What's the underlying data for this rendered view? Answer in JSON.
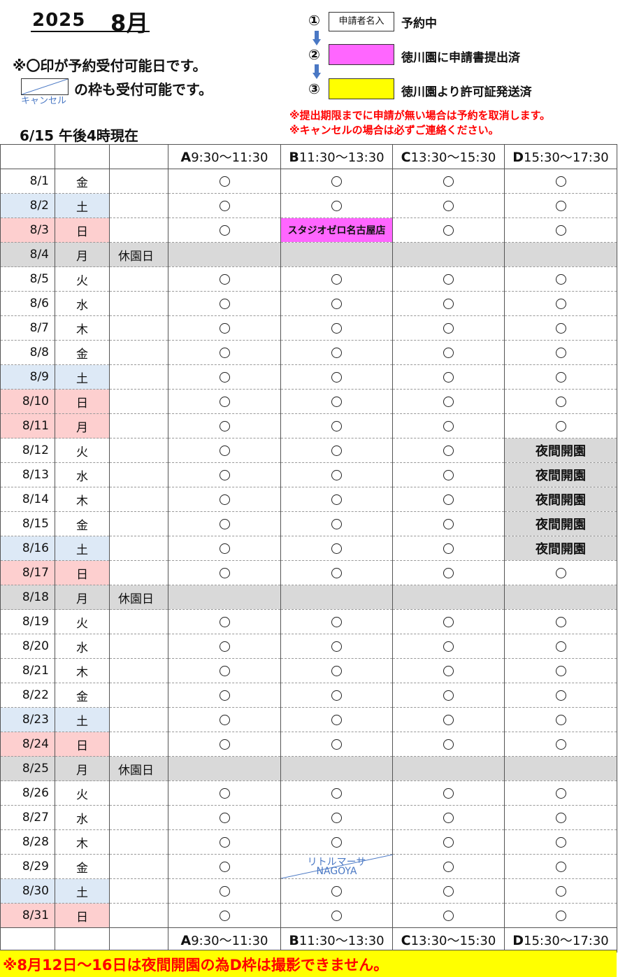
{
  "header": {
    "year": "2025",
    "month": "8月",
    "note_available": "※〇印が予約受付可能日です。",
    "note_cancel_frame": "の枠も受付可能です。",
    "cancel_label": "キャンセル",
    "as_of": "6/15 午後4時現在"
  },
  "legend": {
    "items": [
      {
        "num": "①",
        "box_text": "申請者名入",
        "box_color": "#ffffff",
        "text": "予約中"
      },
      {
        "num": "②",
        "box_text": "",
        "box_color": "#ff66ff",
        "text": "徳川園に申請書提出済"
      },
      {
        "num": "③",
        "box_text": "",
        "box_color": "#ffff00",
        "text": "徳川園より許可証発送済"
      }
    ],
    "warning1": "※提出期限までに申請が無い場合は予約を取消します。",
    "warning2": "※キャンセルの場合は必ずご連絡ください。",
    "arrow_color": "#4a78c4"
  },
  "table": {
    "columns": [
      {
        "letter": "A",
        "time": "9:30～11:30"
      },
      {
        "letter": "B",
        "time": "11:30～13:30"
      },
      {
        "letter": "C",
        "time": "13:30～15:30"
      },
      {
        "letter": "D",
        "time": "15:30～17:30"
      }
    ],
    "colors": {
      "sat": "#dde9f6",
      "sun": "#fdcfcf",
      "closed": "#d9d9d9",
      "applied": "#ff66ff",
      "night": "#d9d9d9",
      "cancel": "#4a78c4"
    },
    "rows": [
      {
        "date": "8/1",
        "dow": "金",
        "type": "",
        "note": "",
        "slots": [
          "o",
          "o",
          "o",
          "o"
        ]
      },
      {
        "date": "8/2",
        "dow": "土",
        "type": "sat",
        "note": "",
        "slots": [
          "o",
          "o",
          "o",
          "o"
        ]
      },
      {
        "date": "8/3",
        "dow": "日",
        "type": "sun",
        "note": "",
        "slots": [
          "o",
          {
            "kind": "applied",
            "text": "スタジオゼロ名古屋店"
          },
          "o",
          "o"
        ]
      },
      {
        "date": "8/4",
        "dow": "月",
        "type": "closed",
        "note": "休園日",
        "slots": [
          "",
          "",
          "",
          ""
        ]
      },
      {
        "date": "8/5",
        "dow": "火",
        "type": "",
        "note": "",
        "slots": [
          "o",
          "o",
          "o",
          "o"
        ]
      },
      {
        "date": "8/6",
        "dow": "水",
        "type": "",
        "note": "",
        "slots": [
          "o",
          "o",
          "o",
          "o"
        ]
      },
      {
        "date": "8/7",
        "dow": "木",
        "type": "",
        "note": "",
        "slots": [
          "o",
          "o",
          "o",
          "o"
        ]
      },
      {
        "date": "8/8",
        "dow": "金",
        "type": "",
        "note": "",
        "slots": [
          "o",
          "o",
          "o",
          "o"
        ]
      },
      {
        "date": "8/9",
        "dow": "土",
        "type": "sat",
        "note": "",
        "slots": [
          "o",
          "o",
          "o",
          "o"
        ]
      },
      {
        "date": "8/10",
        "dow": "日",
        "type": "sun",
        "note": "",
        "slots": [
          "o",
          "o",
          "o",
          "o"
        ]
      },
      {
        "date": "8/11",
        "dow": "月",
        "type": "sun",
        "note": "",
        "slots": [
          "o",
          "o",
          "o",
          "o"
        ]
      },
      {
        "date": "8/12",
        "dow": "火",
        "type": "",
        "note": "",
        "slots": [
          "o",
          "o",
          "o",
          {
            "kind": "night",
            "text": "夜間開園"
          }
        ]
      },
      {
        "date": "8/13",
        "dow": "水",
        "type": "",
        "note": "",
        "slots": [
          "o",
          "o",
          "o",
          {
            "kind": "night",
            "text": "夜間開園"
          }
        ]
      },
      {
        "date": "8/14",
        "dow": "木",
        "type": "",
        "note": "",
        "slots": [
          "o",
          "o",
          "o",
          {
            "kind": "night",
            "text": "夜間開園"
          }
        ]
      },
      {
        "date": "8/15",
        "dow": "金",
        "type": "",
        "note": "",
        "slots": [
          "o",
          "o",
          "o",
          {
            "kind": "night",
            "text": "夜間開園"
          }
        ]
      },
      {
        "date": "8/16",
        "dow": "土",
        "type": "sat",
        "note": "",
        "slots": [
          "o",
          "o",
          "o",
          {
            "kind": "night",
            "text": "夜間開園"
          }
        ]
      },
      {
        "date": "8/17",
        "dow": "日",
        "type": "sun",
        "note": "",
        "slots": [
          "o",
          "o",
          "o",
          "o"
        ]
      },
      {
        "date": "8/18",
        "dow": "月",
        "type": "closed",
        "note": "休園日",
        "slots": [
          "",
          "",
          "",
          ""
        ]
      },
      {
        "date": "8/19",
        "dow": "火",
        "type": "",
        "note": "",
        "slots": [
          "o",
          "o",
          "o",
          "o"
        ]
      },
      {
        "date": "8/20",
        "dow": "水",
        "type": "",
        "note": "",
        "slots": [
          "o",
          "o",
          "o",
          "o"
        ]
      },
      {
        "date": "8/21",
        "dow": "木",
        "type": "",
        "note": "",
        "slots": [
          "o",
          "o",
          "o",
          "o"
        ]
      },
      {
        "date": "8/22",
        "dow": "金",
        "type": "",
        "note": "",
        "slots": [
          "o",
          "o",
          "o",
          "o"
        ]
      },
      {
        "date": "8/23",
        "dow": "土",
        "type": "sat",
        "note": "",
        "slots": [
          "o",
          "o",
          "o",
          "o"
        ]
      },
      {
        "date": "8/24",
        "dow": "日",
        "type": "sun",
        "note": "",
        "slots": [
          "o",
          "o",
          "o",
          "o"
        ]
      },
      {
        "date": "8/25",
        "dow": "月",
        "type": "closed",
        "note": "休園日",
        "slots": [
          "",
          "",
          "",
          ""
        ]
      },
      {
        "date": "8/26",
        "dow": "火",
        "type": "",
        "note": "",
        "slots": [
          "o",
          "o",
          "o",
          "o"
        ]
      },
      {
        "date": "8/27",
        "dow": "水",
        "type": "",
        "note": "",
        "slots": [
          "o",
          "o",
          "o",
          "o"
        ]
      },
      {
        "date": "8/28",
        "dow": "木",
        "type": "",
        "note": "",
        "slots": [
          "o",
          "o",
          "o",
          "o"
        ]
      },
      {
        "date": "8/29",
        "dow": "金",
        "type": "",
        "note": "",
        "slots": [
          "o",
          {
            "kind": "cancel",
            "line1": "リトルマーサ",
            "line2": "NAGOYA"
          },
          "o",
          "o"
        ]
      },
      {
        "date": "8/30",
        "dow": "土",
        "type": "sat",
        "note": "",
        "slots": [
          "o",
          "o",
          "o",
          "o"
        ]
      },
      {
        "date": "8/31",
        "dow": "日",
        "type": "sun",
        "note": "",
        "slots": [
          "o",
          "o",
          "o",
          "o"
        ]
      }
    ]
  },
  "footer": {
    "text": "※8月12日～16日は夜間開園の為D枠は撮影できません。",
    "color": "#ffff00"
  }
}
